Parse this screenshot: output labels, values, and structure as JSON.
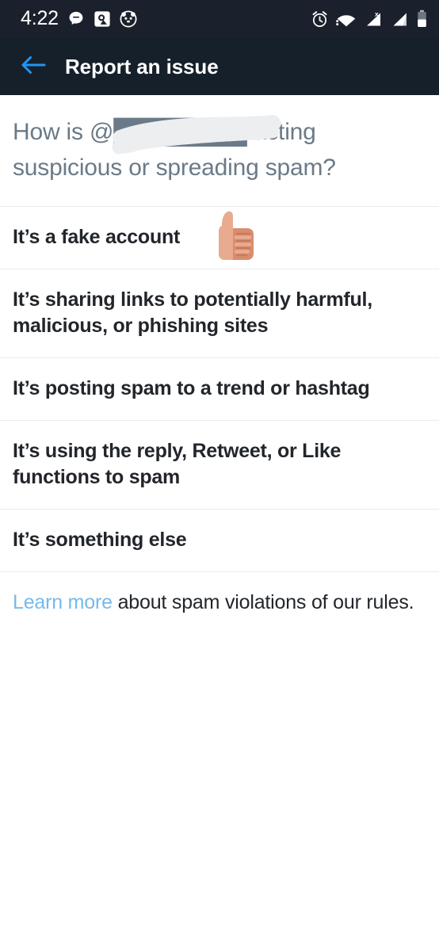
{
  "status_bar": {
    "time": "4:22",
    "left_icons": [
      "message-bubble-icon",
      "photos-app-icon",
      "panda-app-icon"
    ],
    "right_icons": [
      "alarm-clock-icon",
      "wifi-no-internet-icon",
      "signal-no-sim-icon",
      "signal-bars-icon",
      "battery-icon"
    ],
    "background_color": "#1b212c",
    "icon_color": "#ffffff"
  },
  "app_bar": {
    "back_label": "back-arrow",
    "title": "Report an issue",
    "background_color": "#16202b",
    "accent_color": "#2196f3"
  },
  "question": {
    "line1_prefix": "How is ",
    "redacted_handle": "@██████████",
    "line1_suffix": " acting",
    "line2": "suspicious or spreading spam?",
    "full_text": "How is @████████ acting suspicious or spreading spam?",
    "text_color": "#6a7a88",
    "redaction_color": "#eceef0"
  },
  "options": [
    {
      "label": "It’s a fake account",
      "has_annotation": true,
      "annotation_icon": "thumbs-up-icon"
    },
    {
      "label": "It’s sharing links to potentially harmful, malicious, or phishing sites",
      "has_annotation": false
    },
    {
      "label": "It’s posting spam to a trend or hashtag",
      "has_annotation": false
    },
    {
      "label": "It’s using the reply, Retweet, or Like functions to spam",
      "has_annotation": false
    },
    {
      "label": "It’s something else",
      "has_annotation": false
    }
  ],
  "footer": {
    "link_text": "Learn more",
    "rest_text": " about spam violations of our rules.",
    "link_color": "#76b9ea",
    "text_color": "#22262b"
  },
  "theme": {
    "page_background": "#ffffff",
    "divider_color": "#e8edf1",
    "option_text_color": "#22262b"
  }
}
